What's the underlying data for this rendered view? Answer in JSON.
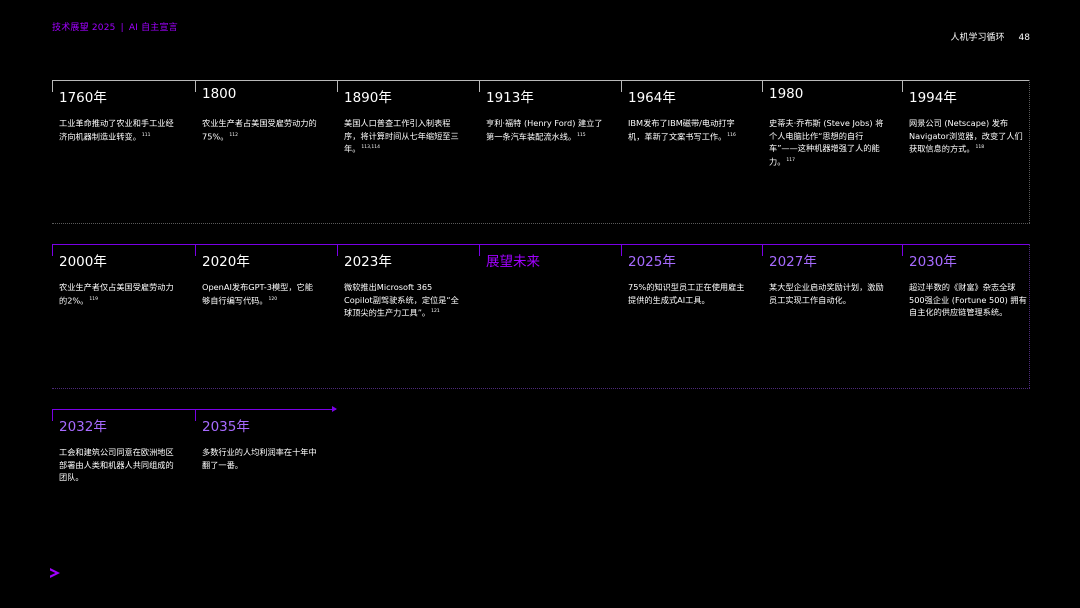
{
  "header": {
    "left": "技术展望 2025",
    "separator": "|",
    "left_sub": "AI 自主宣言",
    "right_title": "人机学习循环",
    "page_number": "48"
  },
  "row1": [
    {
      "year": "1760年",
      "text": "工业革命推动了农业和手工业经济向机器制造业转变。",
      "ref": "111"
    },
    {
      "year": "1800",
      "text": "农业生产者占美国受雇劳动力的75%。",
      "ref": "112"
    },
    {
      "year": "1890年",
      "text": "美国人口普查工作引入制表程序，将计算时间从七年缩短至三年。",
      "ref": "113,114"
    },
    {
      "year": "1913年",
      "text": "亨利·福特 (Henry Ford) 建立了第一条汽车装配流水线。",
      "ref": "115"
    },
    {
      "year": "1964年",
      "text": "IBM发布了IBM磁带/电动打字机，革新了文案书写工作。",
      "ref": "116"
    },
    {
      "year": "1980",
      "text": "史蒂夫·乔布斯 (Steve Jobs) 将个人电脑比作“思想的自行车”——这种机器增强了人的能力。",
      "ref": "117"
    },
    {
      "year": "1994年",
      "text": "网景公司 (Netscape) 发布Navigator浏览器，改变了人们获取信息的方式。",
      "ref": "118"
    }
  ],
  "row2": [
    {
      "year": "2000年",
      "text": "农业生产者仅占美国受雇劳动力的2%。",
      "ref": "119"
    },
    {
      "year": "2020年",
      "text": "OpenAI发布GPT-3模型，它能够自行编写代码。",
      "ref": "120"
    },
    {
      "year": "2023年",
      "text": "微软推出Microsoft 365 Copilot副驾驶系统，定位是“全球顶尖的生产力工具”。",
      "ref": "121"
    },
    {
      "year": "展望未来",
      "text": "",
      "ref": ""
    },
    {
      "year": "2025年",
      "text": "75%的知识型员工正在使用雇主提供的生成式AI工具。",
      "ref": ""
    },
    {
      "year": "2027年",
      "text": "某大型企业启动奖励计划，激励员工实现工作自动化。",
      "ref": ""
    },
    {
      "year": "2030年",
      "text": "超过半数的《财富》杂志全球500强企业 (Fortune 500) 拥有自主化的供应链管理系统。",
      "ref": ""
    }
  ],
  "row3": [
    {
      "year": "2032年",
      "text": "工会和建筑公司同意在欧洲地区部署由人类和机器人共同组成的团队。",
      "ref": ""
    },
    {
      "year": "2035年",
      "text": "多数行业的人均利润率在十年中翻了一番。",
      "ref": ""
    }
  ],
  "colors": {
    "accent": "#a100ff",
    "future": "#a76bff",
    "line": "#b9b9b9"
  },
  "logo_icon": "chevron-right-icon"
}
